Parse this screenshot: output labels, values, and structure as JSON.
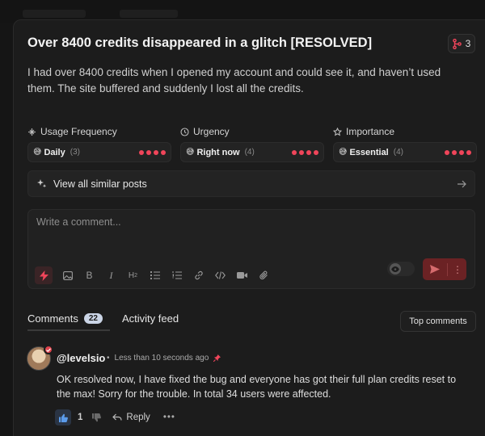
{
  "post": {
    "title": "Over 8400 credits disappeared in a glitch [RESOLVED]",
    "merge_count": "3",
    "description": "I had over 8400 credits when I opened my account and could see it, and haven’t used them. The site buffered and suddenly I lost all the credits."
  },
  "attributes": [
    {
      "label": "Usage Frequency",
      "icon": "sparkle-icon",
      "emoji": "😅",
      "value": "Daily",
      "count": "(3)",
      "level": 4
    },
    {
      "label": "Urgency",
      "icon": "clock-icon",
      "emoji": "😅",
      "value": "Right now",
      "count": "(4)",
      "level": 4
    },
    {
      "label": "Importance",
      "icon": "star-icon",
      "emoji": "😅",
      "value": "Essential",
      "count": "(4)",
      "level": 4
    }
  ],
  "similar": {
    "label": "View all similar posts"
  },
  "composer": {
    "placeholder": "Write a comment...",
    "toolbar": [
      "bolt-icon",
      "image-icon",
      "bold-icon",
      "italic-icon",
      "heading-icon",
      "bullet-list-icon",
      "numbered-list-icon",
      "link-icon",
      "code-icon",
      "video-icon",
      "attachment-icon"
    ]
  },
  "tabs": {
    "comments_label": "Comments",
    "comments_count": "22",
    "activity_label": "Activity feed"
  },
  "sort": {
    "label": "Top comments"
  },
  "comment": {
    "author": "@levelsio",
    "time": "Less than 10 seconds ago",
    "text": "OK resolved now, I have fixed the bug and everyone has got their full plan credits reset to the max! Sorry for the trouble. In total 34 users were affected.",
    "likes": "1",
    "reply_label": "Reply"
  },
  "colors": {
    "accent": "#f0455a",
    "send_button": "#6b2224",
    "background": "#1c1c1c"
  }
}
